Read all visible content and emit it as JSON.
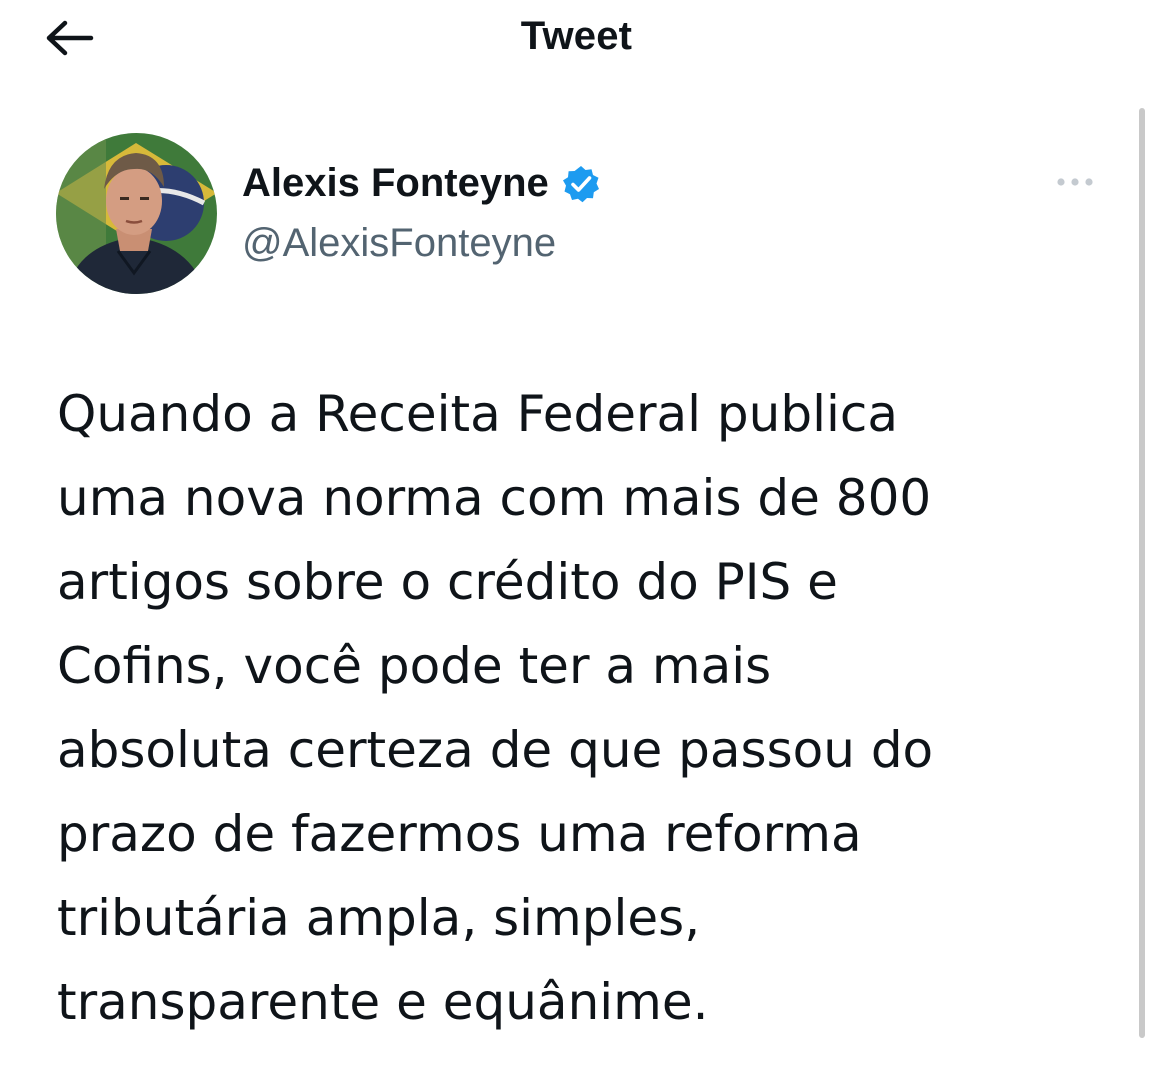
{
  "header": {
    "title": "Tweet",
    "back_icon": "arrow-left-icon"
  },
  "author": {
    "name": "Alexis Fonteyne",
    "handle": "@AlexisFonteyne",
    "verified": true,
    "verified_color": "#1d9bf0",
    "avatar_icon": "avatar"
  },
  "menu": {
    "more_icon": "more-horizontal-icon"
  },
  "tweet": {
    "text": "Quando a Receita Federal publica\numa nova norma com mais de 800\nartigos sobre o crédito do PIS e\nCofins, você pode ter a mais\nabsoluta certeza de que passou do\nprazo de fazermos uma reforma\ntributária ampla, simples,\ntransparente e equânime."
  },
  "colors": {
    "text_primary": "#0f1419",
    "text_secondary": "#536471",
    "accent": "#1d9bf0",
    "background": "#ffffff"
  }
}
